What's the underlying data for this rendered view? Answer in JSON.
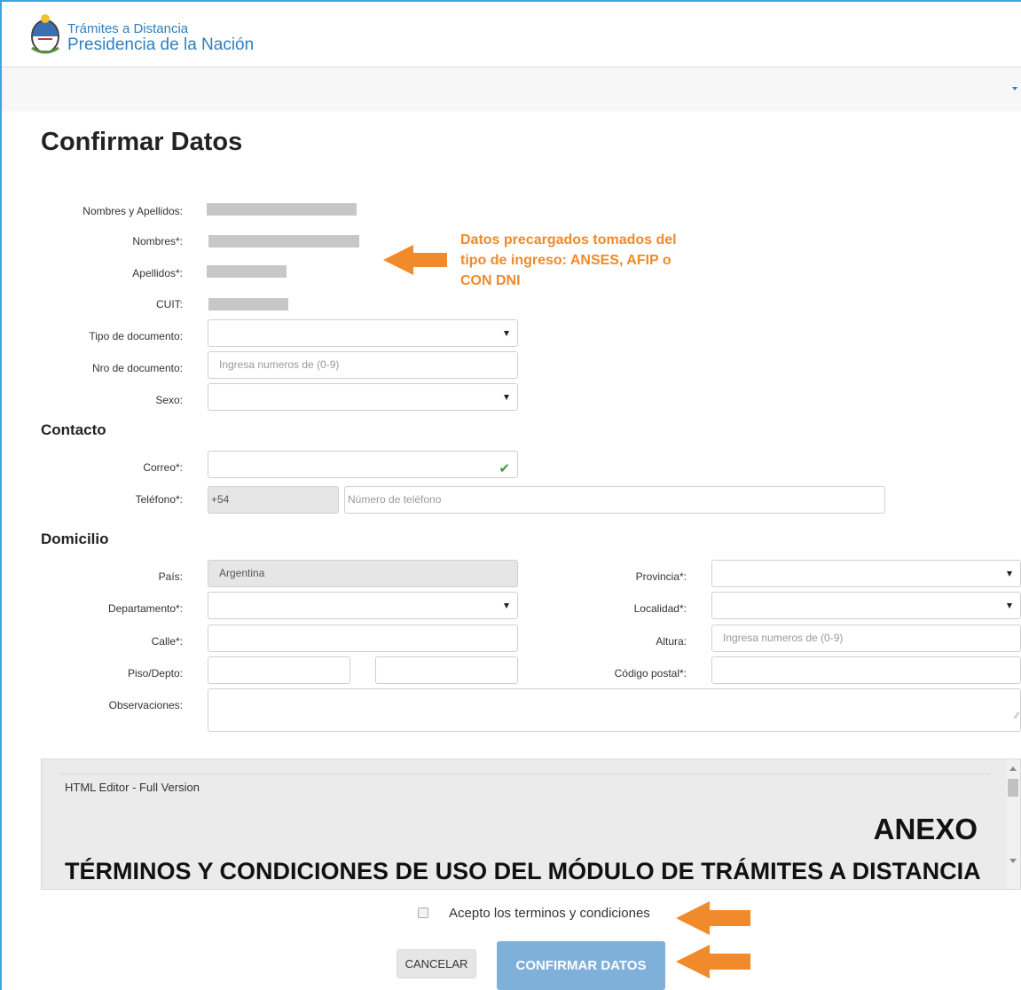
{
  "header": {
    "brand_top": "Trámites a Distancia",
    "brand_main": "Presidencia de la Nación"
  },
  "page": {
    "title": "Confirmar Datos"
  },
  "personal": {
    "nombres_apellidos_label": "Nombres y Apellidos:",
    "nombres_label": "Nombres*:",
    "apellidos_label": "Apellidos*:",
    "cuit_label": "CUIT:",
    "tipo_documento_label": "Tipo de documento:",
    "nro_documento_label": "Nro de documento:",
    "nro_documento_placeholder": "Ingresa numeros de (0-9)",
    "sexo_label": "Sexo:"
  },
  "callout": {
    "text": "Datos precargados tomados del tipo de ingreso: ANSES, AFIP o CON DNI"
  },
  "contacto": {
    "title": "Contacto",
    "correo_label": "Correo*:",
    "telefono_label": "Teléfono*:",
    "telefono_prefix": "+54",
    "telefono_placeholder": "Número de teléfono"
  },
  "domicilio": {
    "title": "Domicilio",
    "pais_label": "País:",
    "pais_value": "Argentina",
    "provincia_label": "Provincia*:",
    "departamento_label": "Departamento*:",
    "localidad_label": "Localidad*:",
    "calle_label": "Calle*:",
    "altura_label": "Altura:",
    "altura_placeholder": "Ingresa numeros de (0-9)",
    "piso_depto_label": "Piso/Depto:",
    "codigo_postal_label": "Código postal*:",
    "observaciones_label": "Observaciones:"
  },
  "editor": {
    "title": "HTML Editor - Full Version",
    "anexo": "ANEXO",
    "terms_heading": "TÉRMINOS Y CONDICIONES DE USO DEL MÓDULO DE TRÁMITES A DISTANCIA"
  },
  "footer": {
    "accept_label": "Acepto los terminos y condiciones",
    "cancel_label": "CANCELAR",
    "confirm_label": "CONFIRMAR DATOS"
  },
  "colors": {
    "brand": "#2e7fc1",
    "callout": "#f08a2a",
    "confirm_button": "#7fb0d9",
    "check": "#3c9a3c"
  }
}
